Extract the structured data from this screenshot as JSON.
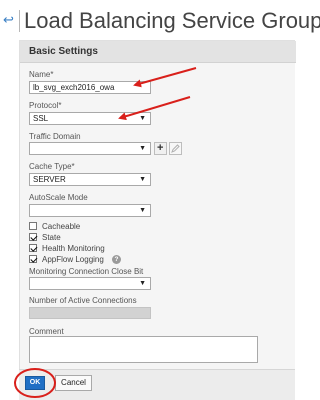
{
  "header": {
    "back_icon": "back-arrow-icon",
    "title": "Load Balancing Service Group"
  },
  "panel": {
    "title": "Basic Settings"
  },
  "form": {
    "name_label": "Name*",
    "name_value": "lb_svg_exch2016_owa",
    "protocol_label": "Protocol*",
    "protocol_value": "SSL",
    "traffic_domain_label": "Traffic Domain",
    "traffic_domain_value": "",
    "add_icon_glyph": "+",
    "edit_icon": "pencil-icon",
    "cache_type_label": "Cache Type*",
    "cache_type_value": "SERVER",
    "autoscale_label": "AutoScale Mode",
    "autoscale_value": "",
    "checkboxes": [
      {
        "label": "Cacheable",
        "checked": false
      },
      {
        "label": "State",
        "checked": true
      },
      {
        "label": "Health Monitoring",
        "checked": true
      },
      {
        "label": "AppFlow Logging",
        "checked": true
      }
    ],
    "help_glyph": "?",
    "monitoring_close_label": "Monitoring Connection Close Bit",
    "monitoring_close_value": "",
    "active_connections_label": "Number of Active Connections",
    "comment_label": "Comment"
  },
  "footer": {
    "ok_label": "OK",
    "cancel_label": "Cancel"
  },
  "annotations": {
    "arrow_color": "#d9201b"
  },
  "colors": {
    "accent": "#1f6fc5",
    "panel_bg": "#f5f5f5",
    "header_bg": "#e3e3e3"
  }
}
